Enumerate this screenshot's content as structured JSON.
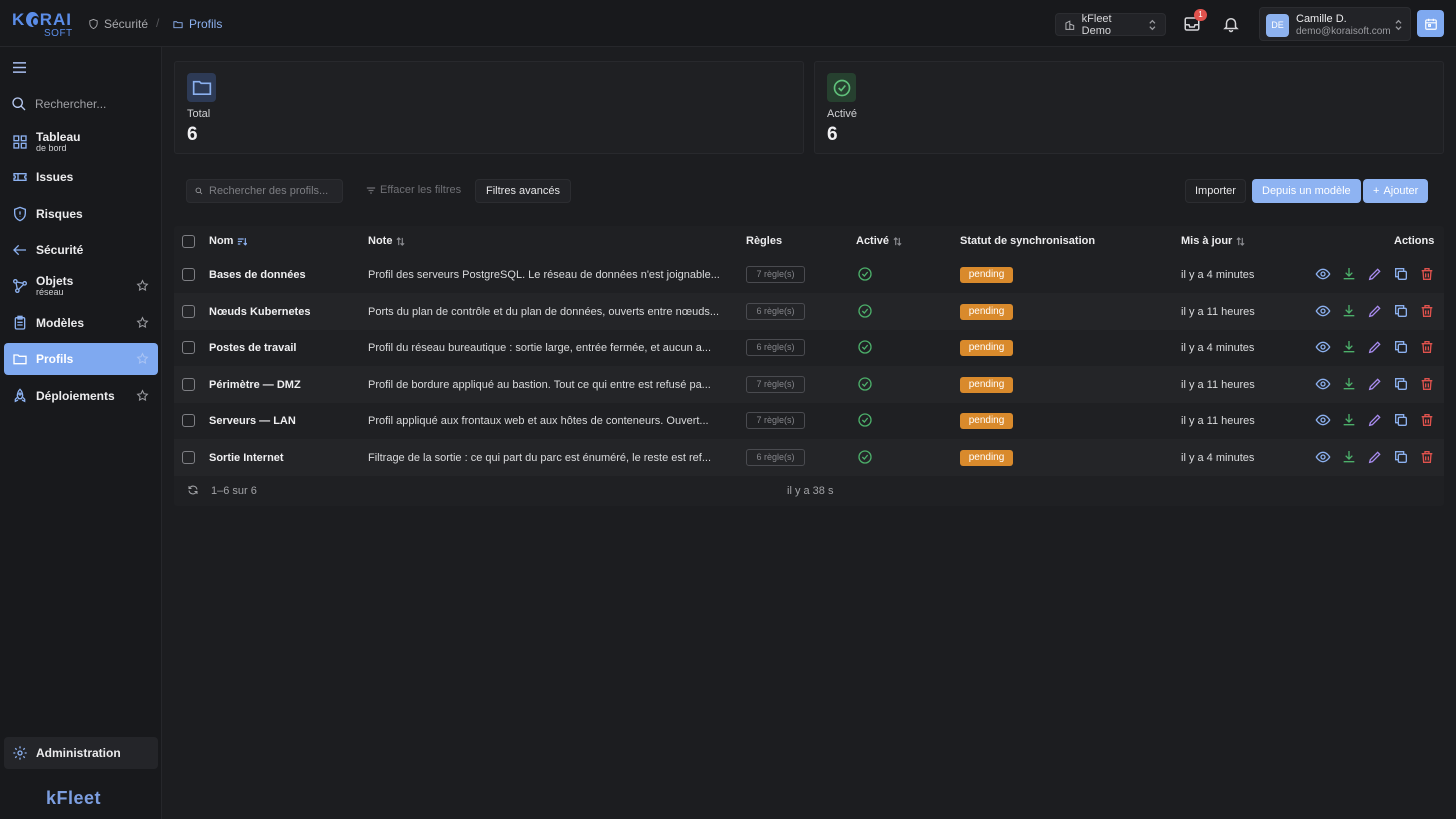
{
  "brand": {
    "logo_top": "KORAI",
    "logo_sub": "SOFT",
    "footer_logo": "kFleet"
  },
  "breadcrumb": [
    {
      "label": "Sécurité"
    },
    {
      "label": "Profils"
    }
  ],
  "header": {
    "tenant": "kFleet Demo",
    "inbox_count": "1",
    "user_initials": "DE",
    "user_name": "Camille D.",
    "user_email": "demo@koraisoft.com"
  },
  "sidebar": {
    "search_placeholder": "Rechercher...",
    "items": [
      {
        "label": "Tableau",
        "sub": "de bord",
        "icon": "dashboard-icon"
      },
      {
        "label": "Issues",
        "sub": "",
        "icon": "ticket-icon"
      },
      {
        "label": "Risques",
        "sub": "",
        "icon": "shield-alert-icon"
      },
      {
        "label": "Sécurité",
        "sub": "",
        "icon": "arrow-left-icon"
      },
      {
        "label": "Objets",
        "sub": "réseau",
        "icon": "network-icon"
      },
      {
        "label": "Modèles",
        "sub": "",
        "icon": "clipboard-icon"
      },
      {
        "label": "Profils",
        "sub": "",
        "icon": "folder-icon"
      },
      {
        "label": "Déploiements",
        "sub": "",
        "icon": "rocket-icon"
      }
    ],
    "admin_label": "Administration"
  },
  "stats": [
    {
      "label": "Total",
      "value": "6"
    },
    {
      "label": "Activé",
      "value": "6"
    }
  ],
  "toolbar": {
    "search_placeholder": "Rechercher des profils...",
    "clear_label": "Effacer les filtres",
    "advanced_label": "Filtres avancés",
    "import_label": "Importer",
    "template_label": "Depuis un modèle",
    "add_label": "Ajouter"
  },
  "table": {
    "headers": {
      "name": "Nom",
      "note": "Note",
      "rules": "Règles",
      "active": "Activé",
      "sync": "Statut de synchronisation",
      "updated": "Mis à jour",
      "actions": "Actions"
    },
    "rows": [
      {
        "name": "Bases de données",
        "note": "Profil des serveurs PostgreSQL. Le réseau de données n'est joignable...",
        "rules": "7 règle(s)",
        "sync": "pending",
        "updated": "il y a 4 minutes"
      },
      {
        "name": "Nœuds Kubernetes",
        "note": "Ports du plan de contrôle et du plan de données, ouverts entre nœuds...",
        "rules": "6 règle(s)",
        "sync": "pending",
        "updated": "il y a 11 heures"
      },
      {
        "name": "Postes de travail",
        "note": "Profil du réseau bureautique : sortie large, entrée fermée, et aucun a...",
        "rules": "6 règle(s)",
        "sync": "pending",
        "updated": "il y a 4 minutes"
      },
      {
        "name": "Périmètre — DMZ",
        "note": "Profil de bordure appliqué au bastion. Tout ce qui entre est refusé pa...",
        "rules": "7 règle(s)",
        "sync": "pending",
        "updated": "il y a 11 heures"
      },
      {
        "name": "Serveurs — LAN",
        "note": "Profil appliqué aux frontaux web et aux hôtes de conteneurs. Ouvert...",
        "rules": "7 règle(s)",
        "sync": "pending",
        "updated": "il y a 11 heures"
      },
      {
        "name": "Sortie Internet",
        "note": "Filtrage de la sortie : ce qui part du parc est énuméré, le reste est ref...",
        "rules": "6 règle(s)",
        "sync": "pending",
        "updated": "il y a 4 minutes"
      }
    ],
    "footer_range": "1–6 sur 6",
    "footer_time": "il y a 38 s"
  },
  "colors": {
    "accent": "#7fa9f0",
    "pending": "#d98a2c",
    "success": "#4caf6a",
    "danger": "#e0524d"
  }
}
